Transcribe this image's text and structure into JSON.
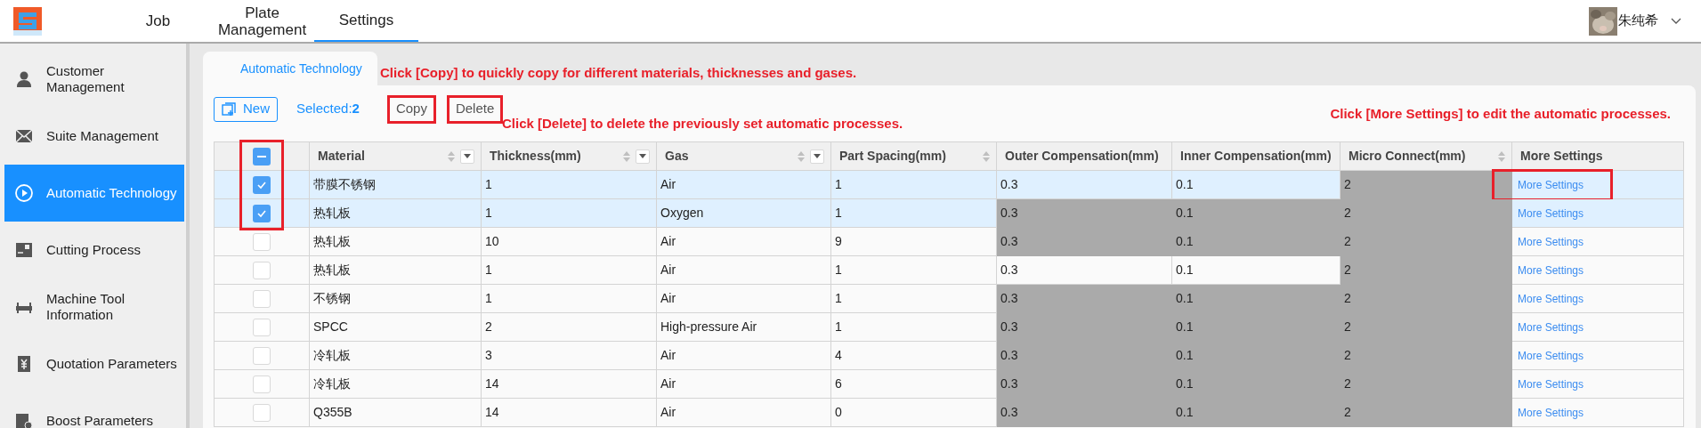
{
  "nav": {
    "tabs": [
      {
        "label": "Job",
        "selected": false
      },
      {
        "label": "Plate Management",
        "selected": false
      },
      {
        "label": "Settings",
        "selected": true
      }
    ],
    "user": {
      "name": "朱纯希"
    }
  },
  "sidebar": {
    "items": [
      {
        "label": "Customer Management",
        "kind": "person",
        "selected": false
      },
      {
        "label": "Suite Management",
        "kind": "envelope",
        "selected": false
      },
      {
        "label": "Automatic Technology",
        "kind": "play",
        "selected": true
      },
      {
        "label": "Cutting Process",
        "kind": "cutting",
        "selected": false
      },
      {
        "label": "Machine Tool Information",
        "kind": "machine",
        "selected": false
      },
      {
        "label": "Quotation Parameters",
        "kind": "yen",
        "selected": false
      },
      {
        "label": "Boost Parameters",
        "kind": "boost",
        "selected": false
      }
    ]
  },
  "page_tab": "Automatic Technology",
  "toolbar": {
    "new_button": "New",
    "selected_label": "Selected:",
    "selected_count": "2",
    "buttons": [
      {
        "label": "Copy",
        "highlighted": true
      },
      {
        "label": "Delete",
        "highlighted": true
      }
    ]
  },
  "annotations": {
    "copy": "Click [Copy] to quickly copy for different materials, thicknesses and gases.",
    "delete": "Click [Delete] to delete the previously set automatic processes.",
    "more": "Click [More Settings] to edit the automatic processes."
  },
  "table": {
    "checkbox_column_highlighted": true,
    "header_checkbox_indeterminate": true,
    "columns": [
      {
        "label": "Material",
        "sortable": true,
        "filterable": true
      },
      {
        "label": "Thickness(mm)",
        "sortable": true,
        "filterable": true
      },
      {
        "label": "Gas",
        "sortable": true,
        "filterable": true
      },
      {
        "label": "Part Spacing(mm)",
        "sortable": true,
        "filterable": false
      },
      {
        "label": "Outer Compensation(mm)",
        "sortable": false,
        "filterable": false
      },
      {
        "label": "Inner Compensation(mm)",
        "sortable": false,
        "filterable": false
      },
      {
        "label": "Micro Connect(mm)",
        "sortable": true,
        "filterable": false
      },
      {
        "label": "More Settings",
        "sortable": false,
        "filterable": false
      }
    ],
    "rows": [
      {
        "selected": true,
        "material": "带膜不锈钢",
        "thickness": "1",
        "gas": "Air",
        "spacing": "1",
        "outer": {
          "text": "0.3",
          "greyed": false
        },
        "inner": {
          "text": "0.1",
          "greyed": false
        },
        "micro": {
          "text": "2",
          "greyed": true
        },
        "link": {
          "label": "More Settings",
          "highlighted": true
        }
      },
      {
        "selected": true,
        "material": "热轧板",
        "thickness": "1",
        "gas": "Oxygen",
        "spacing": "1",
        "outer": {
          "text": "0.3",
          "greyed": true
        },
        "inner": {
          "text": "0.1",
          "greyed": true
        },
        "micro": {
          "text": "2",
          "greyed": true
        },
        "link": {
          "label": "More Settings",
          "highlighted": false
        }
      },
      {
        "selected": false,
        "material": "热轧板",
        "thickness": "10",
        "gas": "Air",
        "spacing": "9",
        "outer": {
          "text": "0.3",
          "greyed": true
        },
        "inner": {
          "text": "0.1",
          "greyed": true
        },
        "micro": {
          "text": "2",
          "greyed": true
        },
        "link": {
          "label": "More Settings",
          "highlighted": false
        }
      },
      {
        "selected": false,
        "material": "热轧板",
        "thickness": "1",
        "gas": "Air",
        "spacing": "1",
        "outer": {
          "text": "0.3",
          "greyed": false
        },
        "inner": {
          "text": "0.1",
          "greyed": false
        },
        "micro": {
          "text": "2",
          "greyed": true
        },
        "link": {
          "label": "More Settings",
          "highlighted": false
        }
      },
      {
        "selected": false,
        "material": "不锈钢",
        "thickness": "1",
        "gas": "Air",
        "spacing": "1",
        "outer": {
          "text": "0.3",
          "greyed": true
        },
        "inner": {
          "text": "0.1",
          "greyed": true
        },
        "micro": {
          "text": "2",
          "greyed": true
        },
        "link": {
          "label": "More Settings",
          "highlighted": false
        }
      },
      {
        "selected": false,
        "material": "SPCC",
        "thickness": "2",
        "gas": "High-pressure Air",
        "spacing": "1",
        "outer": {
          "text": "0.3",
          "greyed": true
        },
        "inner": {
          "text": "0.1",
          "greyed": true
        },
        "micro": {
          "text": "2",
          "greyed": true
        },
        "link": {
          "label": "More Settings",
          "highlighted": false
        }
      },
      {
        "selected": false,
        "material": "冷轧板",
        "thickness": "3",
        "gas": "Air",
        "spacing": "4",
        "outer": {
          "text": "0.3",
          "greyed": true
        },
        "inner": {
          "text": "0.1",
          "greyed": true
        },
        "micro": {
          "text": "2",
          "greyed": true
        },
        "link": {
          "label": "More Settings",
          "highlighted": false
        }
      },
      {
        "selected": false,
        "material": "冷轧板",
        "thickness": "14",
        "gas": "Air",
        "spacing": "6",
        "outer": {
          "text": "0.3",
          "greyed": true
        },
        "inner": {
          "text": "0.1",
          "greyed": true
        },
        "micro": {
          "text": "2",
          "greyed": true
        },
        "link": {
          "label": "More Settings",
          "highlighted": false
        }
      },
      {
        "selected": false,
        "material": "Q355B",
        "thickness": "14",
        "gas": "Air",
        "spacing": "0",
        "outer": {
          "text": "0.3",
          "greyed": true
        },
        "inner": {
          "text": "0.1",
          "greyed": true
        },
        "micro": {
          "text": "2",
          "greyed": true
        },
        "link": {
          "label": "More Settings",
          "highlighted": false
        }
      }
    ]
  }
}
